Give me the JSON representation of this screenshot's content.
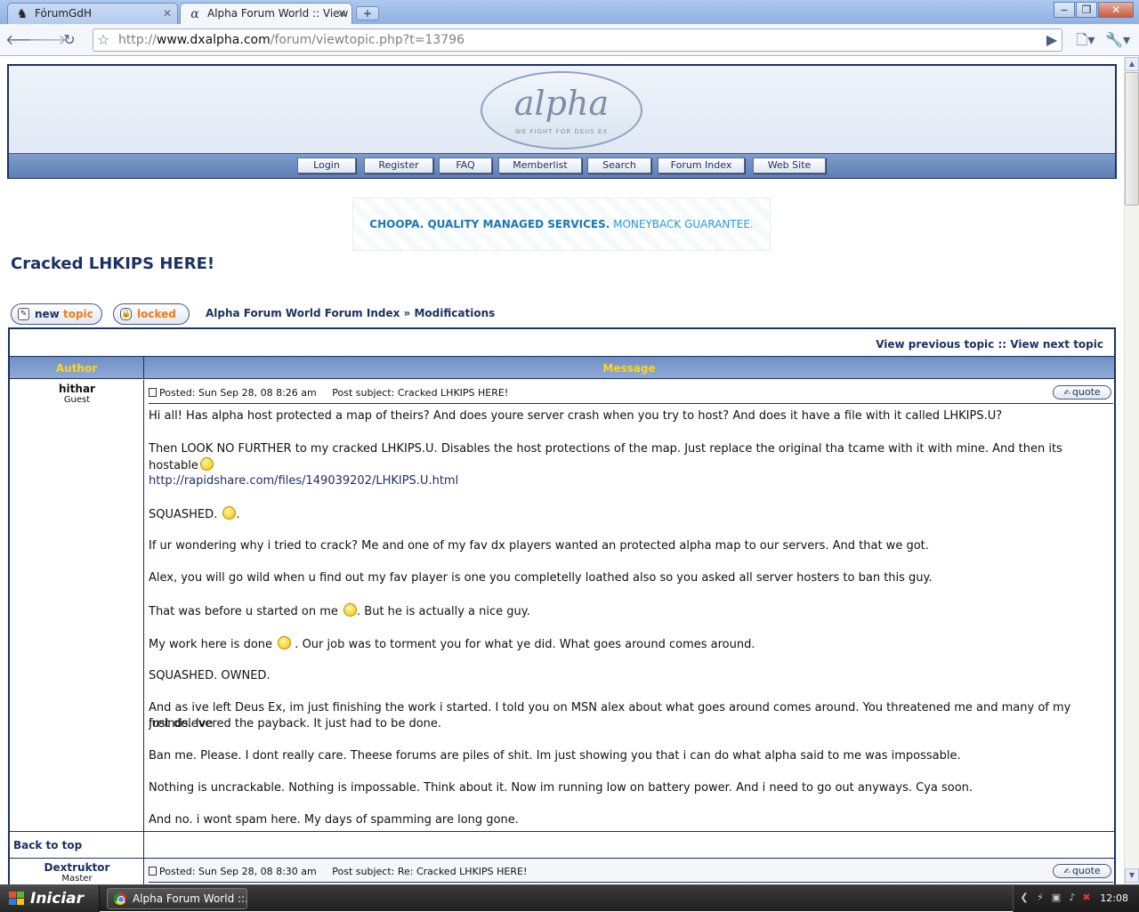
{
  "browser": {
    "tabs": [
      {
        "label": "FórumGdH",
        "icon": "forum-favicon"
      },
      {
        "label": "Alpha Forum World :: View ...",
        "icon": "alpha-favicon"
      }
    ],
    "new_tab_symbol": "+",
    "url_prefix": "http://",
    "url_domain": "www.dxalpha.com",
    "url_path": "/forum/viewtopic.php?t=13796",
    "window_controls": [
      "minimize",
      "restore",
      "close"
    ]
  },
  "site": {
    "logo_text": "alpha",
    "logo_tagline": "WE FIGHT FOR DEUS EX",
    "nav": [
      "Login",
      "Register",
      "FAQ",
      "Memberlist",
      "Search",
      "Forum Index",
      "Web Site"
    ],
    "banner": {
      "brand": "CHOOPA. QUALITY MANAGED SERVICES.",
      "tagline": " MONEYBACK GUARANTEE."
    }
  },
  "topic": {
    "title": "Cracked LHKIPS HERE!",
    "new_topic_a": "new",
    "new_topic_b": "topic",
    "locked_label": "locked",
    "breadcrumb_index": "Alpha Forum World Forum Index",
    "breadcrumb_sep": "»",
    "breadcrumb_forum": "Modifications",
    "prev_topic": "View previous topic",
    "nav_sep": "::",
    "next_topic": "View next topic",
    "col_author": "Author",
    "col_message": "Message"
  },
  "posts": [
    {
      "author": "hithar",
      "rank": "Guest",
      "posted": "Posted: Sun Sep 28, 08 8:26 am",
      "subject": "Post subject: Cracked LHKIPS HERE!",
      "quote_label": "quote",
      "lines": [
        "Hi all! Has alpha host protected a map of theirs? And does youre server crash when you try to host? And does it have a file with it called LHKIPS.U?",
        "Then LOOK NO FURTHER to my cracked LHKIPS.U. Disables the host protections of the map. Just replace the original tha tcame with it with mine. And then its hostable",
        "http://rapidshare.com/files/149039202/LHKIPS.U.html",
        "SQUASHED.",
        "If ur wondering why i tried to crack? Me and one of my fav dx players wanted an protected alpha map to our servers. And that we got.",
        "Alex, you will go wild when u find out my fav player is one you completelly loathed also so you asked all server hosters to ban this guy.",
        "That was before u started on me",
        ". But he is actually a nice guy.",
        "My work here is done",
        " . Our job was to torment you for what ye did. What goes around comes around.",
        "SQUASHED. OWNED.",
        "And as ive left Deus Ex, im just finishing the work i started. I told you on MSN alex about what goes around comes around. You threatened me and many of my freinds. Ive",
        "just delevered the payback. It just had to be done.",
        "Ban me. Please. I dont really care. Theese forums are piles of shit. Im just showing you that i can do what alpha said to me was impossable.",
        "Nothing is uncrackable. Nothing is impossable. Think about it. Now im running low on battery power. And i need to go out anyways. Cya soon.",
        "And no. i wont spam here. My days of spamming are long gone."
      ],
      "back_to_top": "Back to top"
    },
    {
      "author": "Dextruktor",
      "rank": "Master",
      "posted": "Posted: Sun Sep 28, 08 8:30 am",
      "subject": "Post subject: Re: Cracked LHKIPS HERE!",
      "quote_label": "quote"
    }
  ],
  "taskbar": {
    "start_label": "Iniciar",
    "item_label": "Alpha Forum World ::...",
    "clock": "12:08"
  },
  "colors": {
    "forum_navy": "#1c3163",
    "header_yellow": "#ffd61b",
    "topic_orange": "#f07b14"
  }
}
